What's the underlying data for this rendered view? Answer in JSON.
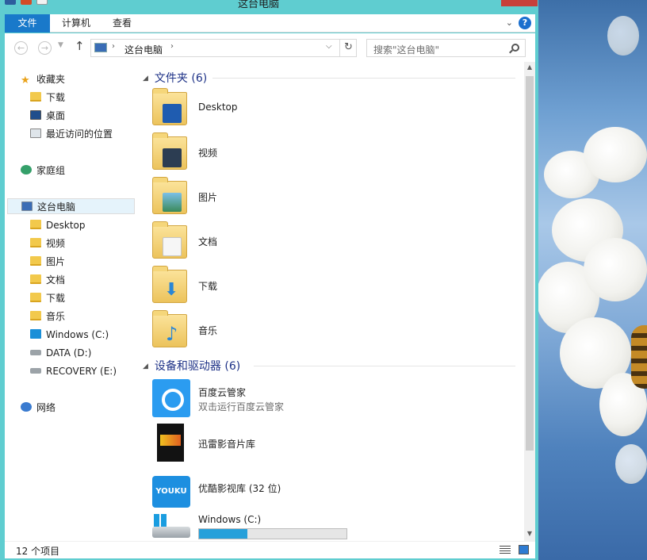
{
  "window": {
    "title": "这台电脑"
  },
  "ribbon": {
    "tabs": [
      "文件",
      "计算机",
      "查看"
    ],
    "help": "?"
  },
  "address": {
    "path_item": "这台电脑",
    "search_placeholder": "搜索\"这台电脑\""
  },
  "nav": {
    "favorites_label": "收藏夹",
    "favorites": [
      "下载",
      "桌面",
      "最近访问的位置"
    ],
    "homegroup_label": "家庭组",
    "thispc_label": "这台电脑",
    "thispc_items": [
      "Desktop",
      "视频",
      "图片",
      "文档",
      "下载",
      "音乐",
      "Windows (C:)",
      "DATA (D:)",
      "RECOVERY (E:)"
    ],
    "network_label": "网络"
  },
  "folders_group": {
    "title": "文件夹 (6)",
    "items": [
      "Desktop",
      "视频",
      "图片",
      "文档",
      "下载",
      "音乐"
    ]
  },
  "devices_group": {
    "title": "设备和驱动器 (6)",
    "items": [
      {
        "label": "百度云管家",
        "sub": "双击运行百度云管家"
      },
      {
        "label": "迅雷影音片库"
      },
      {
        "label": "优酷影视库 (32 位)",
        "icon_text": "YOUKU"
      },
      {
        "label": "Windows (C:)",
        "usage_fraction": 0.33
      }
    ]
  },
  "status": {
    "item_count": "12 个项目"
  },
  "colors": {
    "accent": "#1979ca",
    "window_frame": "#5fcdd0",
    "usage_bar": "#26a0da"
  }
}
